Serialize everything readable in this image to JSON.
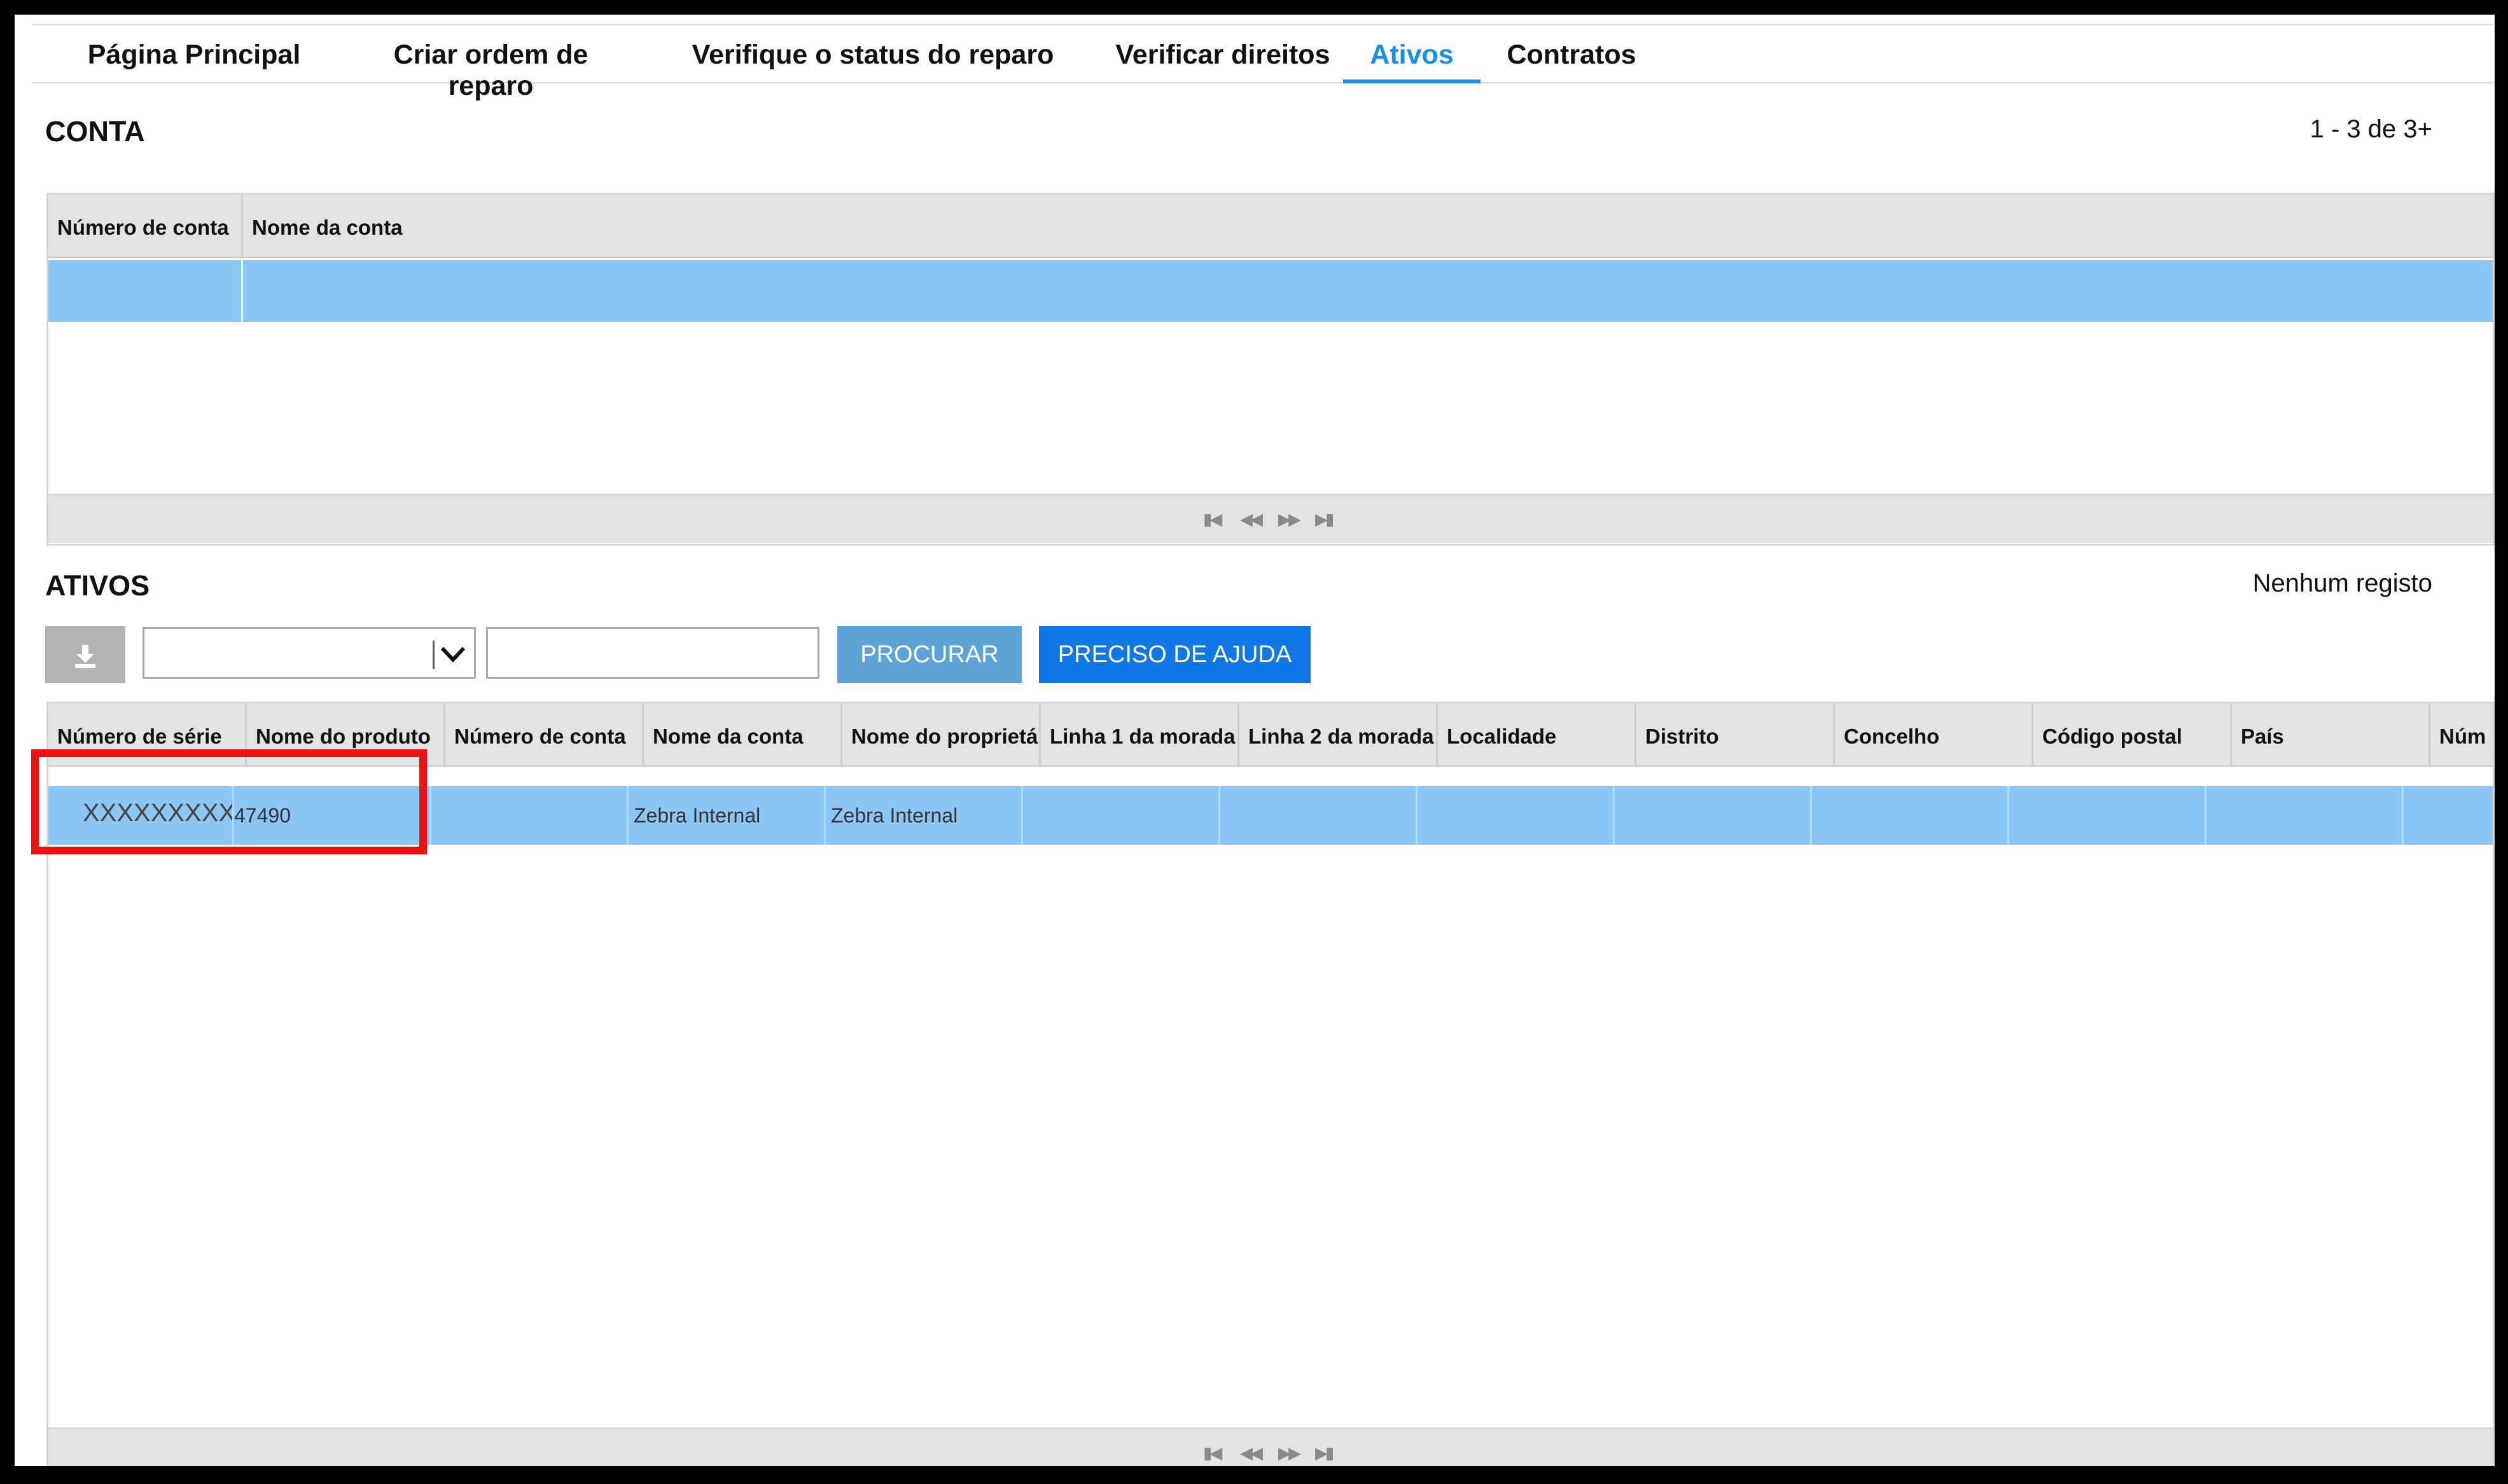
{
  "nav": {
    "tabs": [
      {
        "label": "Página Principal"
      },
      {
        "label": "Criar ordem de reparo"
      },
      {
        "label": "Verifique o status do reparo"
      },
      {
        "label": "Verificar direitos"
      },
      {
        "label": "Ativos",
        "active": true
      },
      {
        "label": "Contratos"
      }
    ]
  },
  "conta": {
    "title": "CONTA",
    "count": "1 - 3 de 3+",
    "columns": [
      "Número de conta",
      "Nome da conta"
    ],
    "selected_row": [
      "",
      ""
    ]
  },
  "ativos": {
    "title": "ATIVOS",
    "count": "Nenhum registo",
    "download_icon": "download-icon",
    "select_value": "",
    "search_value": "",
    "procurar_label": "PROCURAR",
    "ajuda_label": "PRECISO DE AJUDA",
    "columns": [
      "Número de série",
      "Nome do produto",
      "Número de conta",
      "Nome da conta",
      "Nome do proprietár",
      "Linha 1 da morada",
      "Linha 2 da morada",
      "Localidade",
      "Distrito",
      "Concelho",
      "Código postal",
      "País",
      "Núm"
    ],
    "row": {
      "serial": "XXXXXXXXXXXX",
      "account_number": "47490",
      "owner_name": "Zebra Internal",
      "address_line1": "Zebra Internal"
    }
  },
  "pager": {
    "first": "first-page-icon",
    "prev": "prev-page-icon",
    "next": "next-page-icon",
    "last": "last-page-icon"
  },
  "colors": {
    "accent": "#1a8fe6",
    "selected_row": "#8cc6f5",
    "header_bg": "#e3e3e3",
    "procurar_bg": "#5ea3d6",
    "ajuda_bg": "#0f78e6",
    "highlight": "#ee1111"
  }
}
